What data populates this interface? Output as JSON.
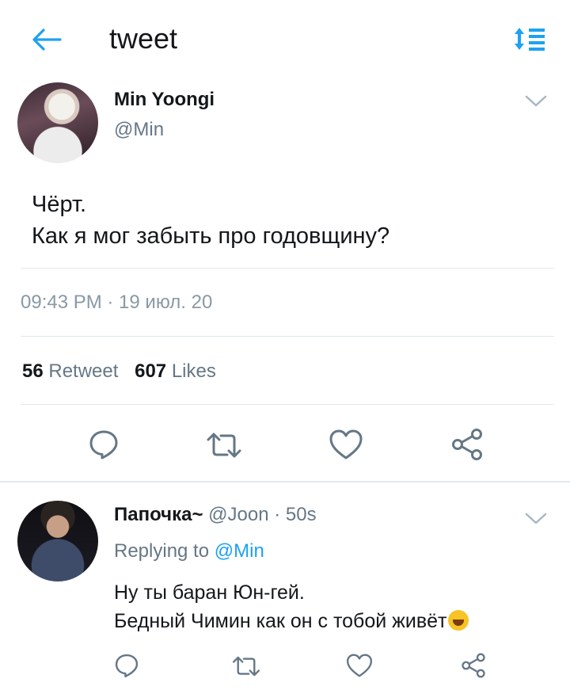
{
  "header": {
    "title": "tweet"
  },
  "main_tweet": {
    "author_name": "Min Yoongi",
    "author_handle": "@Min",
    "text_line1": "Чёрт.",
    "text_line2": "Как я мог забыть про годовщину?",
    "timestamp": "09:43 PM · 19 июл. 20",
    "retweet_count": "56",
    "retweet_label": "Retweet",
    "likes_count": "607",
    "likes_label": "Likes"
  },
  "reply": {
    "author_name": "Папочка~",
    "author_handle": "@Joon",
    "time": "· 50s",
    "replying_prefix": "Replying to",
    "replying_mention": "@Min",
    "text_line1": "Ну ты баран Юн-гей.",
    "text_line2": "Бедный Чимин как он с тобой живёт",
    "emoji": "rolling-on-floor-laughing-emoji"
  },
  "icons": {
    "back": "back-arrow-icon",
    "sort": "sort-icon",
    "reply": "reply-icon",
    "retweet": "retweet-icon",
    "like": "heart-icon",
    "share": "share-icon",
    "more": "chevron-down-icon"
  },
  "colors": {
    "accent": "#1da1f2",
    "secondary_text": "#657786",
    "divider": "#e1e8ed"
  }
}
